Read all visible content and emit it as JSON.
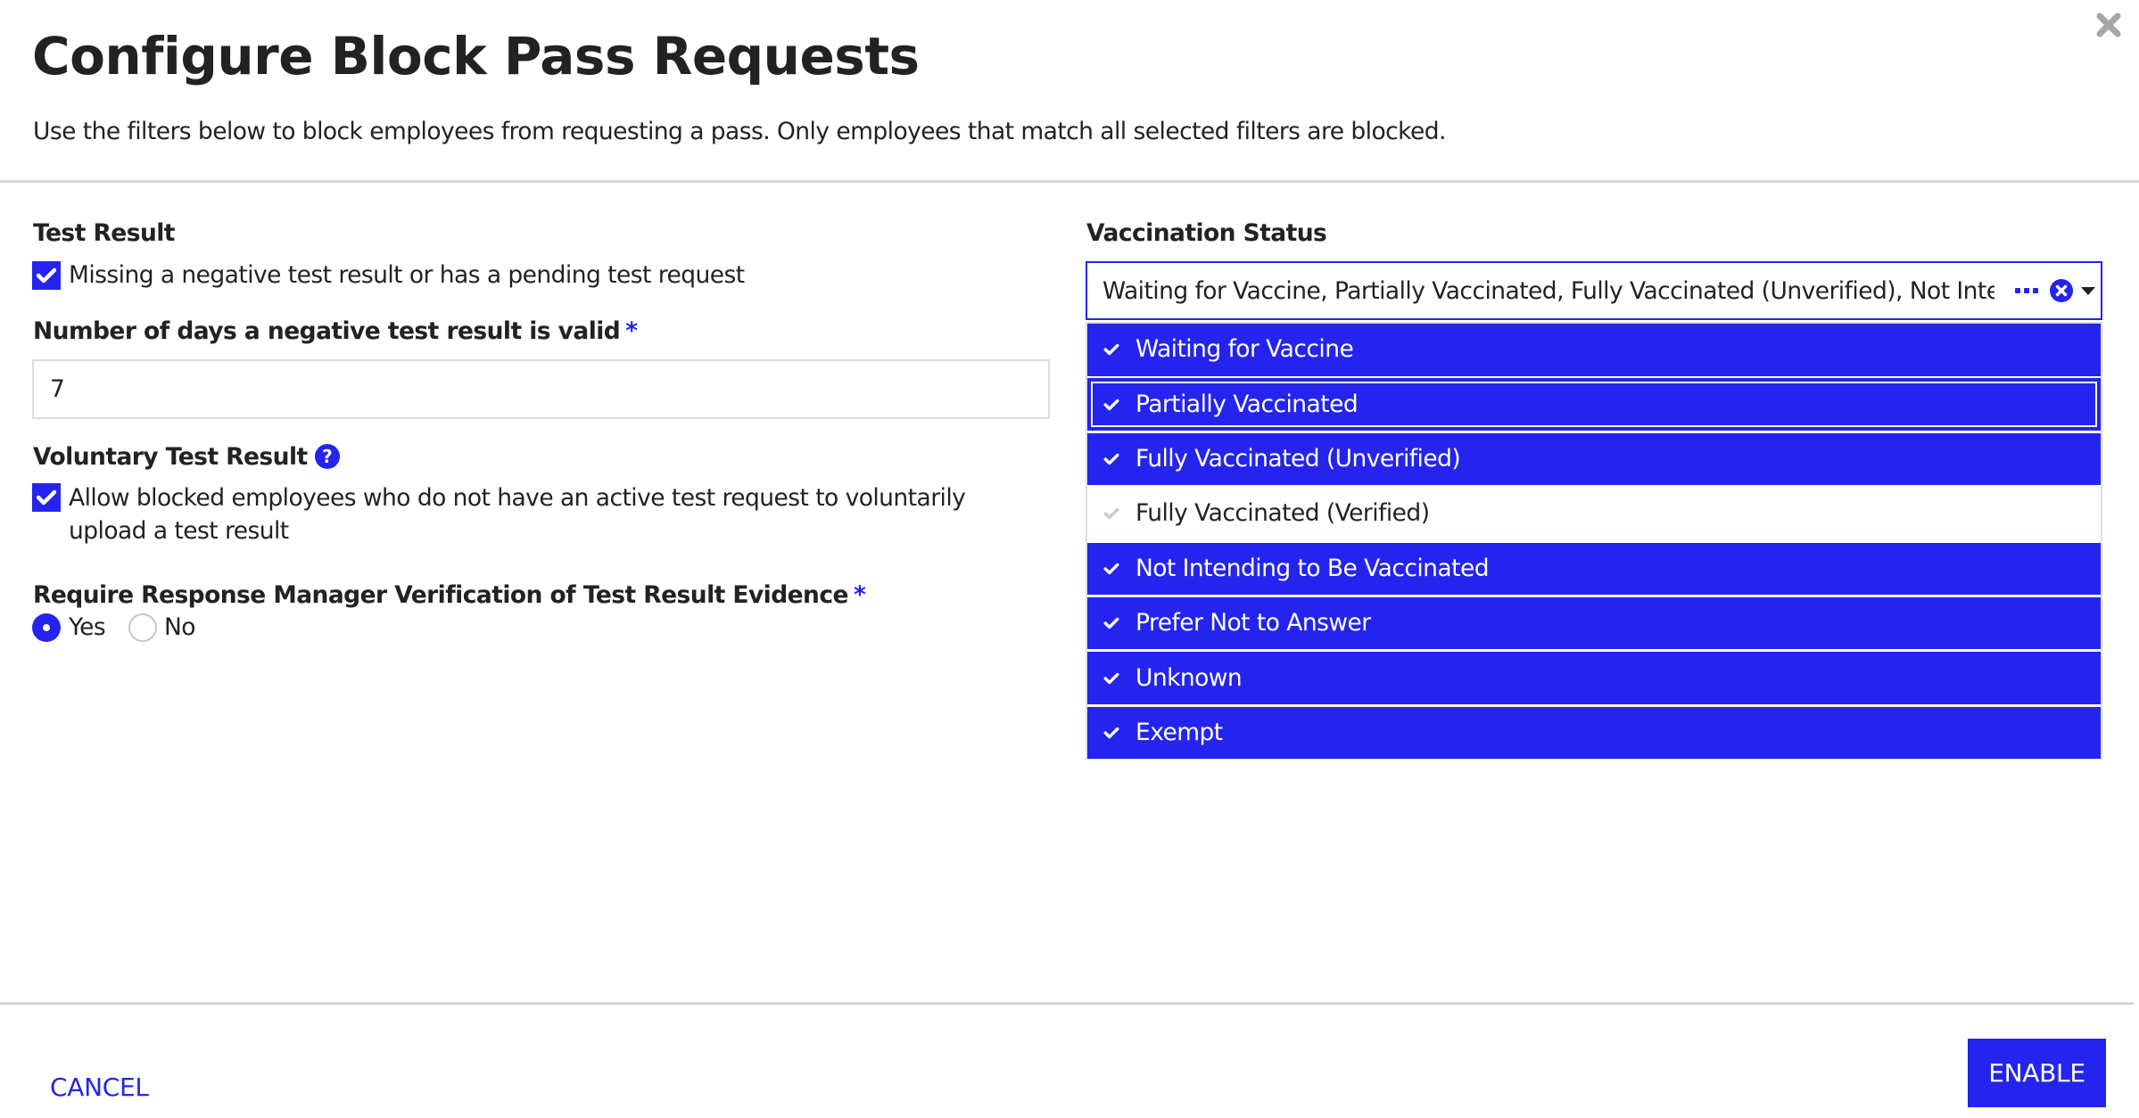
{
  "dialog": {
    "title": "Configure Block Pass Requests",
    "subtitle": "Use the filters below to block employees from requesting a pass. Only employees that match all selected filters are blocked.",
    "close_icon": "close-x-icon"
  },
  "test_result": {
    "label": "Test Result",
    "checkbox_label": "Missing a negative test result or has a pending test request",
    "checked": true
  },
  "valid_days": {
    "label": "Number of days a negative test result is valid",
    "required_mark": "*",
    "value": "7"
  },
  "voluntary": {
    "label": "Voluntary Test Result",
    "help_icon": "?",
    "checkbox_label": "Allow blocked employees who do not have an active test request to voluntarily upload a test result",
    "checked": true
  },
  "verification": {
    "label": "Require Response Manager Verification of Test Result Evidence",
    "required_mark": "*",
    "options": [
      {
        "label": "Yes",
        "selected": true
      },
      {
        "label": "No",
        "selected": false
      }
    ]
  },
  "vaccination": {
    "label": "Vaccination Status",
    "display_value": "Waiting for Vaccine, Partially Vaccinated, Fully Vaccinated (Unverified), Not Intending to Be Vaccinated, Prefer Not to Answer, Unknown, Exempt",
    "options": [
      {
        "label": "Waiting for Vaccine",
        "selected": true,
        "focused": false
      },
      {
        "label": "Partially Vaccinated",
        "selected": true,
        "focused": true
      },
      {
        "label": "Fully Vaccinated (Unverified)",
        "selected": true,
        "focused": false
      },
      {
        "label": "Fully Vaccinated (Verified)",
        "selected": false,
        "focused": false
      },
      {
        "label": "Not Intending to Be Vaccinated",
        "selected": true,
        "focused": false
      },
      {
        "label": "Prefer Not to Answer",
        "selected": true,
        "focused": false
      },
      {
        "label": "Unknown",
        "selected": true,
        "focused": false
      },
      {
        "label": "Exempt",
        "selected": true,
        "focused": false
      }
    ]
  },
  "footer": {
    "cancel_label": "CANCEL",
    "enable_label": "ENABLE"
  },
  "colors": {
    "accent": "#2424ee",
    "text": "#222222",
    "divider": "#d6d6d6",
    "unselected_check": "#cccccc"
  }
}
